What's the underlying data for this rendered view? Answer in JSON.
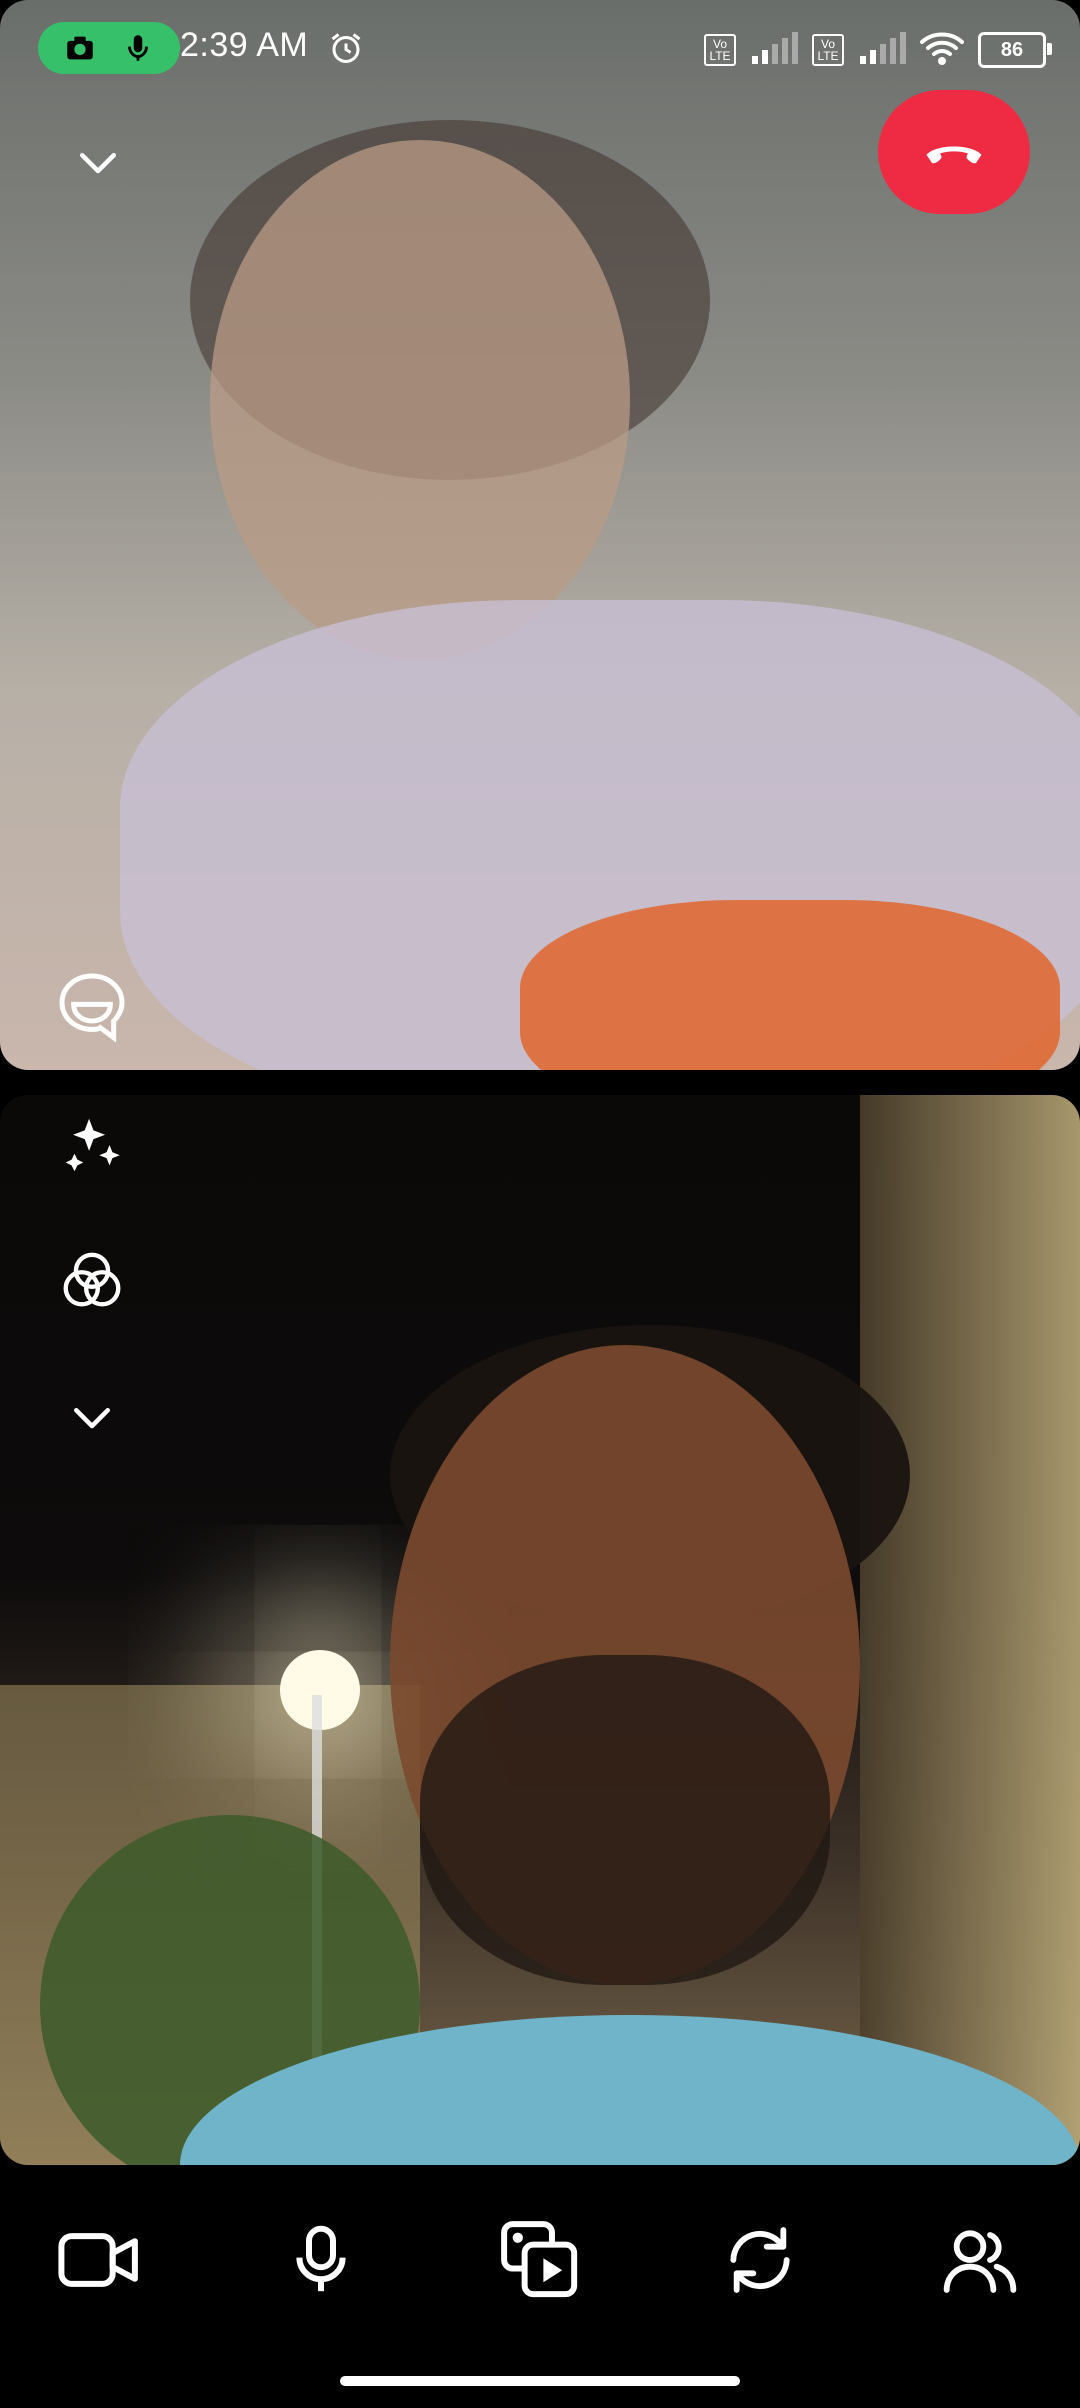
{
  "status_bar": {
    "time": "2:39 AM",
    "battery": "86",
    "sim1_label": "Vo LTE",
    "sim2_label": "Vo LTE"
  },
  "icons": {
    "camera": "camera-icon",
    "mic": "microphone-icon",
    "alarm": "alarm-icon",
    "collapse": "chevron-down-icon",
    "hangup": "phone-hangup-icon",
    "chat": "chat-bubble-icon",
    "effects": "sparkles-icon",
    "filters": "color-filter-icon",
    "more": "chevron-down-icon",
    "video": "video-camera-icon",
    "microphone": "microphone-icon",
    "share_media": "media-share-icon",
    "flip": "switch-camera-icon",
    "participants": "participants-icon"
  },
  "colors": {
    "hangup": "#ef2b43",
    "recording_pill": "#37c06a"
  }
}
